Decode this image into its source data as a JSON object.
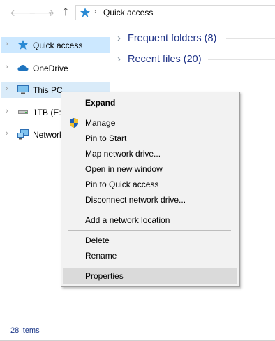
{
  "nav": {
    "back_icon": "arrow-left-icon",
    "forward_icon": "arrow-right-icon",
    "recent_icon": "chevron-down-icon",
    "up_icon": "arrow-up-icon",
    "address_path": "Quick access",
    "address_sep": "›"
  },
  "sidebar": {
    "items": [
      {
        "label": "Quick access",
        "icon": "star-icon"
      },
      {
        "label": "OneDrive",
        "icon": "cloud-icon"
      },
      {
        "label": "This PC",
        "icon": "computer-icon"
      },
      {
        "label": "1TB (E:)",
        "icon": "drive-icon"
      },
      {
        "label": "Network",
        "icon": "network-icon"
      }
    ]
  },
  "main": {
    "groups": [
      {
        "title": "Frequent folders (8)"
      },
      {
        "title": "Recent files (20)"
      }
    ]
  },
  "context_menu": {
    "items": {
      "expand": "Expand",
      "manage": "Manage",
      "pin_to_start": "Pin to Start",
      "map_network_drive": "Map network drive...",
      "open_new_window": "Open in new window",
      "pin_quick_access": "Pin to Quick access",
      "disconnect_network_drive": "Disconnect network drive...",
      "add_network_location": "Add a network location",
      "delete": "Delete",
      "rename": "Rename",
      "properties": "Properties"
    }
  },
  "status": {
    "items_count": "28 items"
  },
  "colors": {
    "selection": "#cce8ff",
    "heading": "#1e3287",
    "menu_bg": "#f2f2f2",
    "menu_hover": "#dadada"
  }
}
